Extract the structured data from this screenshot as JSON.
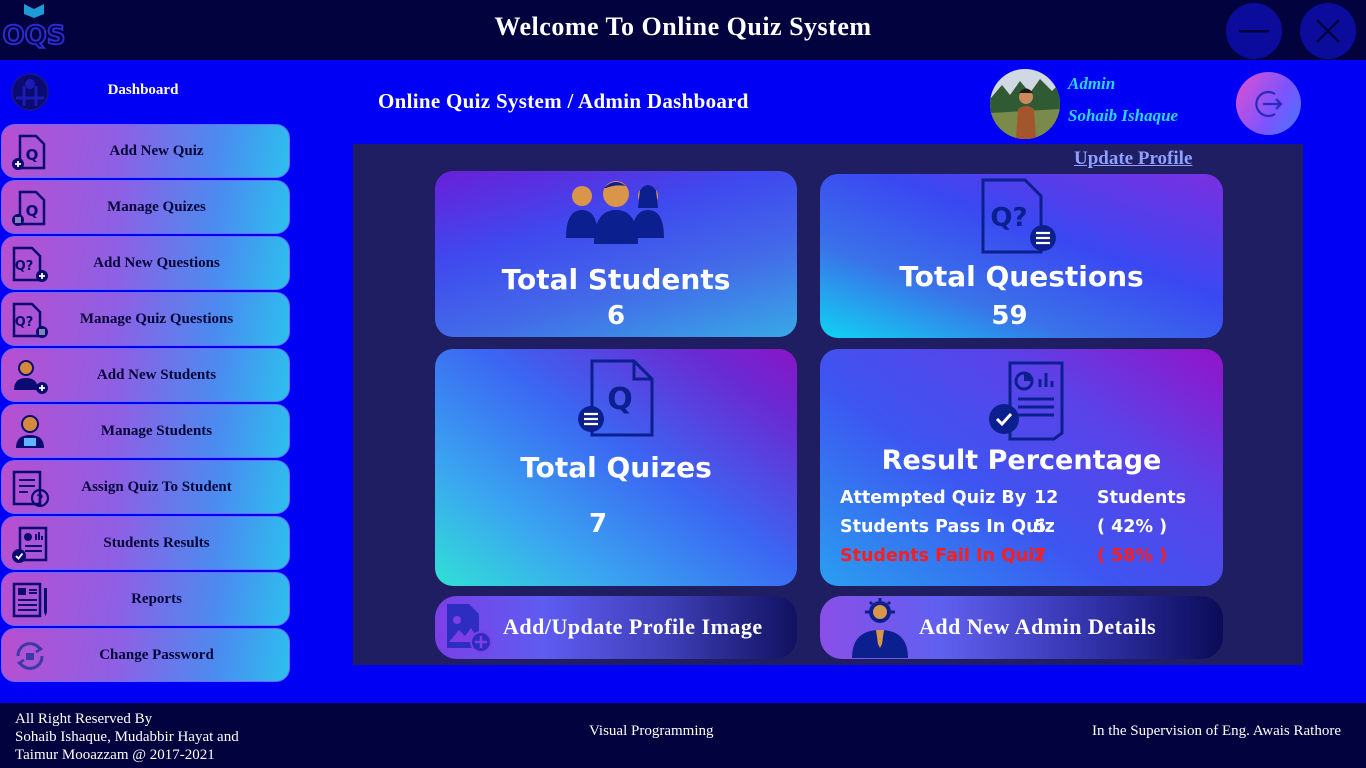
{
  "app": {
    "title": "Welcome To  Online Quiz System",
    "logo_text": "OQS",
    "window": {
      "minimize_icon": "minus-icon",
      "close_icon": "close-icon"
    }
  },
  "sidebar": {
    "header": {
      "label": "Dashboard",
      "icon": "dashboard-icon"
    },
    "items": [
      {
        "label": "Add New Quiz",
        "icon": "add-quiz-icon"
      },
      {
        "label": "Manage Quizes",
        "icon": "manage-quiz-icon"
      },
      {
        "label": "Add New Questions",
        "icon": "add-question-icon"
      },
      {
        "label": "Manage Quiz Questions",
        "icon": "manage-question-icon"
      },
      {
        "label": "Add New Students",
        "icon": "add-student-icon"
      },
      {
        "label": "Manage Students",
        "icon": "manage-student-icon"
      },
      {
        "label": "Assign Quiz To Student",
        "icon": "assign-quiz-icon"
      },
      {
        "label": "Students Results",
        "icon": "results-icon"
      },
      {
        "label": "Reports",
        "icon": "report-icon"
      },
      {
        "label": "Change Password",
        "icon": "change-password-icon"
      }
    ]
  },
  "header": {
    "breadcrumb": "Online Quiz System / Admin Dashboard",
    "user": {
      "role": "Admin",
      "name": "Sohaib Ishaque"
    },
    "logout_icon": "logout-icon"
  },
  "main": {
    "update_profile": "Update Profile",
    "cards": {
      "students": {
        "title": "Total Students",
        "value": "6"
      },
      "questions": {
        "title": "Total Questions",
        "value": "59"
      },
      "quizes": {
        "title": "Total Quizes",
        "value": "7"
      },
      "results": {
        "title": "Result Percentage",
        "rows": [
          {
            "label": "Attempted Quiz By",
            "num": "12",
            "extra": "Students"
          },
          {
            "label": "Students Pass In Quiz",
            "num": "5",
            "extra": "( 42% )"
          },
          {
            "label": "Students Fail In Quiz",
            "num": "7",
            "extra": "( 58% )"
          }
        ]
      }
    },
    "buttons": {
      "profile_image": "Add/Update Profile Image",
      "add_admin": "Add New Admin Details"
    }
  },
  "footer": {
    "copyright_line1": "All Right Reserved By",
    "copyright_line2": "Sohaib Ishaque, Mudabbir Hayat and",
    "copyright_line3": "Taimur Mooazzam @ 2017-2021",
    "course": "Visual Programming",
    "supervision": "In the Supervision of Eng. Awais Rathore"
  },
  "colors": {
    "background": "#0000f5",
    "bar": "#02023e",
    "panel": "#1f1e62",
    "accent_cyan": "#2ad6ff",
    "fail_red": "#ff1c1c"
  }
}
